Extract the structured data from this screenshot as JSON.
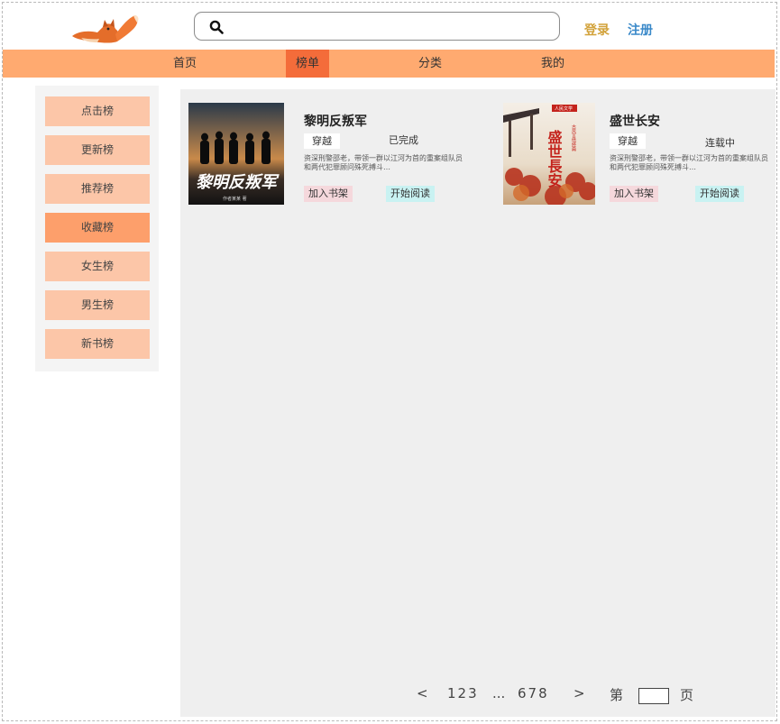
{
  "header": {
    "search_placeholder": "",
    "search_value": "",
    "login_label": "登录",
    "register_label": "注册"
  },
  "nav": {
    "items": [
      {
        "label": "首页"
      },
      {
        "label": "榜单",
        "active": true
      },
      {
        "label": "分类"
      },
      {
        "label": "我的"
      }
    ]
  },
  "sidebar": {
    "items": [
      {
        "label": "点击榜"
      },
      {
        "label": "更新榜"
      },
      {
        "label": "推荐榜"
      },
      {
        "label": "收藏榜",
        "active": true
      },
      {
        "label": "女生榜"
      },
      {
        "label": "男生榜"
      },
      {
        "label": "新书榜"
      }
    ]
  },
  "books": [
    {
      "title": "黎明反叛军",
      "tag": "穿越",
      "status": "已完成",
      "desc": "资深刑警邵老，带领一群以江河为首的重案组队员和两代犯罪顾问殊死搏斗…",
      "add_label": "加入书架",
      "read_label": "开始阅读",
      "cover_text": "黎明反叛军",
      "cover_author": "作者某某 著"
    },
    {
      "title": "盛世长安",
      "tag": "穿越",
      "status": "连载中",
      "desc": "资深刑警邵老，带领一群以江河为首的重案组队员和两代犯罪顾问殊死搏斗…",
      "add_label": "加入书架",
      "read_label": "开始阅读",
      "cover_text": "盛世長安",
      "cover_sub": "人民文学",
      "cover_side": "古风言情经典"
    }
  ],
  "pagination": {
    "prev": "<",
    "pages_a": "123",
    "ellipsis": "...",
    "pages_b": "678",
    "next": ">",
    "page_prefix": "第",
    "page_suffix": "页"
  },
  "colors": {
    "nav_bg": "#ffaa70",
    "nav_active": "#f46c3a",
    "side_btn": "#fcc6a8",
    "side_active": "#fd9f6b",
    "login": "#d2a23a",
    "register": "#3a89c9"
  }
}
